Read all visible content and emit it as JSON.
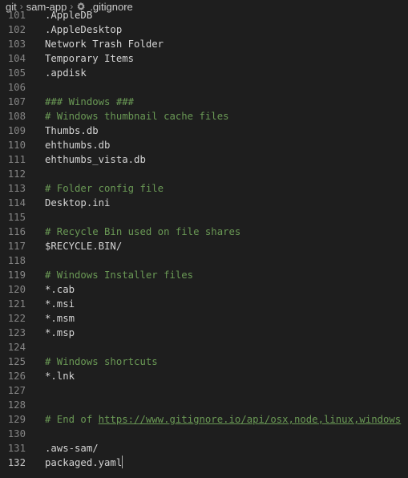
{
  "breadcrumb": {
    "items": [
      "git",
      "sam-app",
      ".gitignore"
    ],
    "file_icon": "gear-file-icon"
  },
  "editor": {
    "active_line": "132",
    "lines": [
      {
        "n": "101",
        "text": ".AppleDB",
        "type": "plain"
      },
      {
        "n": "102",
        "text": ".AppleDesktop",
        "type": "plain"
      },
      {
        "n": "103",
        "text": "Network Trash Folder",
        "type": "plain"
      },
      {
        "n": "104",
        "text": "Temporary Items",
        "type": "plain"
      },
      {
        "n": "105",
        "text": ".apdisk",
        "type": "plain"
      },
      {
        "n": "106",
        "text": "",
        "type": "plain"
      },
      {
        "n": "107",
        "text": "### Windows ###",
        "type": "comment"
      },
      {
        "n": "108",
        "text": "# Windows thumbnail cache files",
        "type": "comment"
      },
      {
        "n": "109",
        "text": "Thumbs.db",
        "type": "plain"
      },
      {
        "n": "110",
        "text": "ehthumbs.db",
        "type": "plain"
      },
      {
        "n": "111",
        "text": "ehthumbs_vista.db",
        "type": "plain"
      },
      {
        "n": "112",
        "text": "",
        "type": "plain"
      },
      {
        "n": "113",
        "text": "# Folder config file",
        "type": "comment"
      },
      {
        "n": "114",
        "text": "Desktop.ini",
        "type": "plain"
      },
      {
        "n": "115",
        "text": "",
        "type": "plain"
      },
      {
        "n": "116",
        "text": "# Recycle Bin used on file shares",
        "type": "comment"
      },
      {
        "n": "117",
        "text": "$RECYCLE.BIN/",
        "type": "plain"
      },
      {
        "n": "118",
        "text": "",
        "type": "plain"
      },
      {
        "n": "119",
        "text": "# Windows Installer files",
        "type": "comment"
      },
      {
        "n": "120",
        "text": "*.cab",
        "type": "plain"
      },
      {
        "n": "121",
        "text": "*.msi",
        "type": "plain"
      },
      {
        "n": "122",
        "text": "*.msm",
        "type": "plain"
      },
      {
        "n": "123",
        "text": "*.msp",
        "type": "plain"
      },
      {
        "n": "124",
        "text": "",
        "type": "plain"
      },
      {
        "n": "125",
        "text": "# Windows shortcuts",
        "type": "comment"
      },
      {
        "n": "126",
        "text": "*.lnk",
        "type": "plain"
      },
      {
        "n": "127",
        "text": "",
        "type": "plain"
      },
      {
        "n": "128",
        "text": "",
        "type": "plain"
      },
      {
        "n": "129",
        "text": "# End of https://www.gitignore.io/api/osx,node,linux,windows",
        "type": "comment",
        "prefix": "# End of ",
        "link": "https://www.gitignore.io/api/osx,node,linux,windows"
      },
      {
        "n": "130",
        "text": "",
        "type": "plain"
      },
      {
        "n": "131",
        "text": ".aws-sam/",
        "type": "plain"
      },
      {
        "n": "132",
        "text": "packaged.yaml",
        "type": "plain"
      }
    ]
  },
  "colors": {
    "background": "#1e1e1e",
    "text": "#d4d4d4",
    "comment": "#6a9955",
    "line_number": "#858585",
    "active_line_number": "#c6c6c6"
  }
}
